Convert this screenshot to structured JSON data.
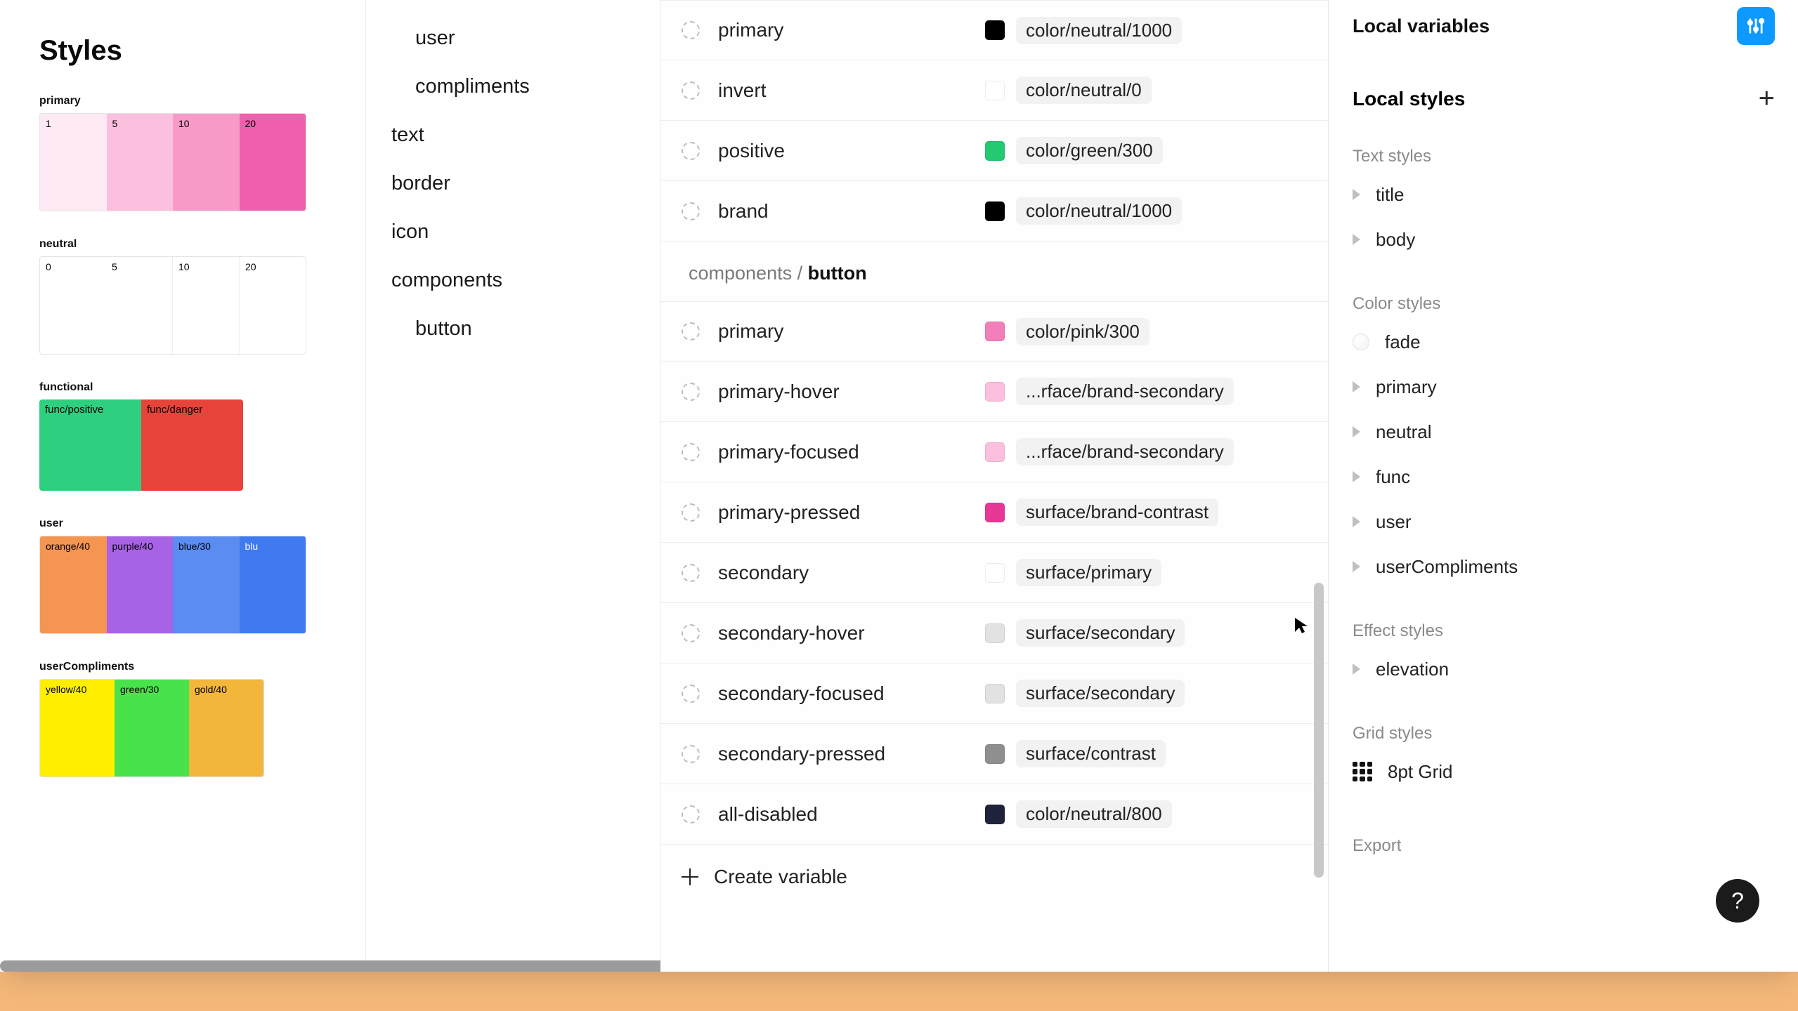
{
  "canvas": {
    "title": "Styles",
    "palettes": {
      "primary": {
        "label": "primary",
        "swatches": [
          {
            "label": "1",
            "bg": "#fdeaf4",
            "fg": "#222"
          },
          {
            "label": "5",
            "bg": "#fbc0dd",
            "fg": "#222"
          },
          {
            "label": "10",
            "bg": "#f79ac8",
            "fg": "#222"
          },
          {
            "label": "20",
            "bg": "#f05fad",
            "fg": "#222"
          }
        ]
      },
      "neutral": {
        "label": "neutral",
        "swatches": [
          {
            "label": "0",
            "bg": "#ffffff",
            "fg": "#222"
          },
          {
            "label": "5",
            "bg": "#ffffff",
            "fg": "#222"
          },
          {
            "label": "10",
            "bg": "#ffffff",
            "fg": "#222"
          },
          {
            "label": "20",
            "bg": "#ffffff",
            "fg": "#222"
          }
        ]
      },
      "functional": {
        "label": "functional",
        "swatches": [
          {
            "label": "func/positive",
            "bg": "#2ecf7f",
            "fg": "#111"
          },
          {
            "label": "func/danger",
            "bg": "#e6443a",
            "fg": "#111"
          }
        ]
      },
      "user": {
        "label": "user",
        "swatches": [
          {
            "label": "orange/40",
            "bg": "#f59552",
            "fg": "#111"
          },
          {
            "label": "purple/40",
            "bg": "#a862e6",
            "fg": "#111"
          },
          {
            "label": "blue/30",
            "bg": "#5a8cf2",
            "fg": "#111"
          },
          {
            "label": "blu",
            "bg": "#3f7af0",
            "fg": "#fff"
          }
        ]
      },
      "userCompliments": {
        "label": "userCompliments",
        "swatches": [
          {
            "label": "yellow/40",
            "bg": "#ffee00",
            "fg": "#111"
          },
          {
            "label": "green/30",
            "bg": "#48e24b",
            "fg": "#111"
          },
          {
            "label": "gold/40",
            "bg": "#f2b63a",
            "fg": "#111"
          }
        ]
      }
    }
  },
  "tree": {
    "items": [
      {
        "label": "user",
        "level": 1
      },
      {
        "label": "compliments",
        "level": 1
      },
      {
        "label": "text",
        "level": 0
      },
      {
        "label": "border",
        "level": 0
      },
      {
        "label": "icon",
        "level": 0
      },
      {
        "label": "components",
        "level": 0
      },
      {
        "label": "button",
        "level": 1
      }
    ]
  },
  "vars": {
    "top_group": [
      {
        "name": "primary",
        "alias": "color/neutral/1000",
        "chip": "#000000"
      },
      {
        "name": "invert",
        "alias": "color/neutral/0",
        "chip": "#ffffff"
      },
      {
        "name": "positive",
        "alias": "color/green/300",
        "chip": "#24c972"
      },
      {
        "name": "brand",
        "alias": "color/neutral/1000",
        "chip": "#000000"
      }
    ],
    "section_path": "components /",
    "section_leaf": "button",
    "button_group": [
      {
        "name": "primary",
        "alias": "color/pink/300",
        "chip": "#f37fba"
      },
      {
        "name": "primary-hover",
        "alias": "...rface/brand-secondary",
        "chip": "#fbc0dd"
      },
      {
        "name": "primary-focused",
        "alias": "...rface/brand-secondary",
        "chip": "#fbc0dd"
      },
      {
        "name": "primary-pressed",
        "alias": "surface/brand-contrast",
        "chip": "#e83897"
      },
      {
        "name": "secondary",
        "alias": "surface/primary",
        "chip": "#ffffff"
      },
      {
        "name": "secondary-hover",
        "alias": "surface/secondary",
        "chip": "#e2e2e2"
      },
      {
        "name": "secondary-focused",
        "alias": "surface/secondary",
        "chip": "#e2e2e2"
      },
      {
        "name": "secondary-pressed",
        "alias": "surface/contrast",
        "chip": "#8f8f8f"
      },
      {
        "name": "all-disabled",
        "alias": "color/neutral/800",
        "chip": "#20213a"
      }
    ],
    "create": "Create variable"
  },
  "inspector": {
    "title": "Local variables",
    "local_styles": "Local styles",
    "text_styles": {
      "label": "Text styles",
      "items": [
        "title",
        "body"
      ]
    },
    "color_styles": {
      "label": "Color styles",
      "fade": "fade",
      "items": [
        "primary",
        "neutral",
        "func",
        "user",
        "userCompliments"
      ]
    },
    "effect_styles": {
      "label": "Effect styles",
      "items": [
        "elevation"
      ]
    },
    "grid_styles": {
      "label": "Grid styles",
      "item": "8pt Grid"
    },
    "export": "Export"
  }
}
